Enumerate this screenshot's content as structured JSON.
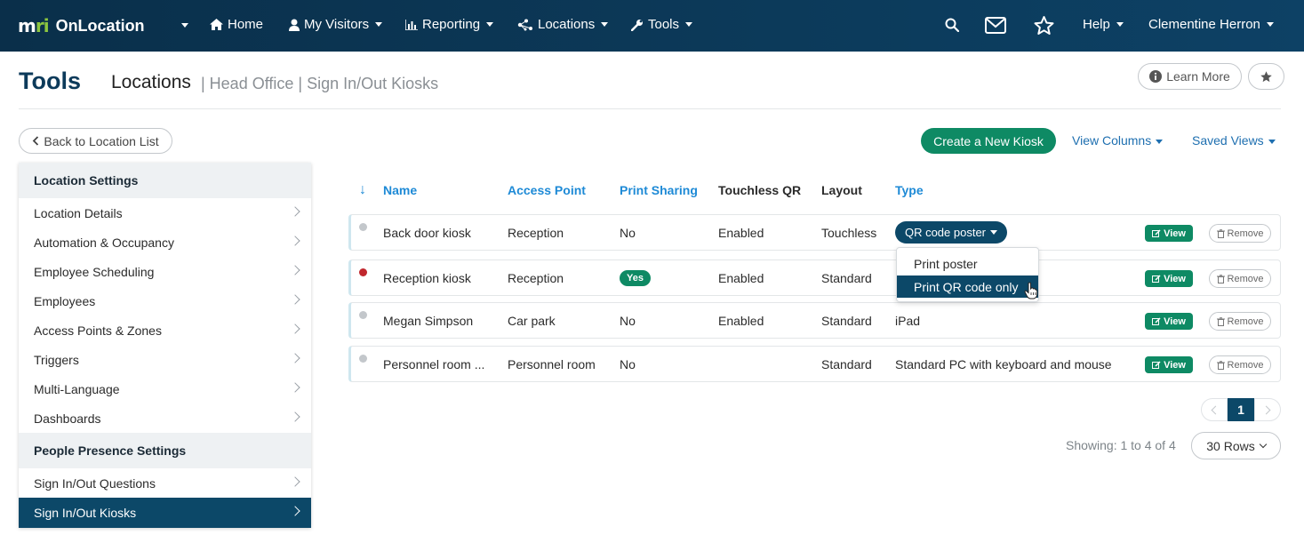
{
  "nav": {
    "logo_mark_m": "m",
    "logo_mark_ri": "ri",
    "app_name": "OnLocation",
    "items": [
      {
        "label": "Home",
        "icon": "home-icon"
      },
      {
        "label": "My Visitors",
        "icon": "user-icon"
      },
      {
        "label": "Reporting",
        "icon": "bar-chart-icon"
      },
      {
        "label": "Locations",
        "icon": "network-icon"
      },
      {
        "label": "Tools",
        "icon": "wrench-icon"
      }
    ],
    "help": "Help",
    "user": "Clementine Herron"
  },
  "header": {
    "title": "Tools",
    "crumb_main": "Locations",
    "crumb_rest": "| Head Office | Sign In/Out Kiosks",
    "learn_more": "Learn More"
  },
  "toolbar": {
    "back": "Back to Location List",
    "create": "Create a New Kiosk",
    "view_columns": "View Columns",
    "saved_views": "Saved Views"
  },
  "sidebar": {
    "section1": "Location Settings",
    "items1": [
      "Location Details",
      "Automation & Occupancy",
      "Employee Scheduling",
      "Employees",
      "Access Points & Zones",
      "Triggers",
      "Multi-Language",
      "Dashboards"
    ],
    "section2": "People Presence Settings",
    "items2": [
      "Sign In/Out Questions",
      "Sign In/Out Kiosks"
    ]
  },
  "table": {
    "sort_arrow": "↓",
    "columns": [
      "Name",
      "Access Point",
      "Print Sharing",
      "Touchless QR",
      "Layout",
      "Type"
    ],
    "rows": [
      {
        "name": "Back door kiosk",
        "access_point": "Reception",
        "print_sharing": "No",
        "touchless_qr": "Enabled",
        "layout": "Touchless",
        "type": "QR code poster",
        "status": "grey"
      },
      {
        "name": "Reception kiosk",
        "access_point": "Reception",
        "print_sharing": "Yes",
        "touchless_qr": "Enabled",
        "layout": "Standard",
        "type": "",
        "status": "red"
      },
      {
        "name": "Megan Simpson",
        "access_point": "Car park",
        "print_sharing": "No",
        "touchless_qr": "Enabled",
        "layout": "Standard",
        "type": "iPad",
        "status": "grey"
      },
      {
        "name": "Personnel room ...",
        "access_point": "Personnel room",
        "print_sharing": "No",
        "touchless_qr": "",
        "layout": "Standard",
        "type": "Standard PC with keyboard and mouse",
        "status": "grey"
      }
    ],
    "view_label": "View",
    "remove_label": "Remove"
  },
  "dropdown": {
    "options": [
      "Print poster",
      "Print QR code only"
    ],
    "highlighted": "Print QR code only"
  },
  "pager": {
    "current": "1",
    "showing": "Showing: 1 to 4 of 4",
    "rows": "30 Rows"
  },
  "colors": {
    "navy": "#0c4868",
    "green": "#0e8a64",
    "link": "#1e8ad6",
    "red_status": "#c0272d"
  }
}
